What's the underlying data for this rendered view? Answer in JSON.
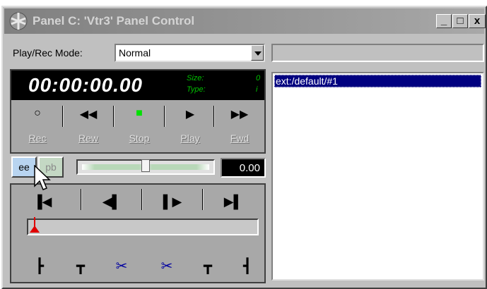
{
  "window": {
    "title": "Panel C: 'Vtr3' Panel Control",
    "controls": [
      "_",
      "□",
      "x"
    ]
  },
  "mode": {
    "label": "Play/Rec Mode:",
    "selected": "Normal"
  },
  "timecode": {
    "value": "00:00:00.00",
    "size_label": "Size:",
    "size_value": "0",
    "type_label": "Type:",
    "type_value": "i"
  },
  "transport": [
    {
      "label": "Rec",
      "icon": "record-circle-icon"
    },
    {
      "label": "Rew",
      "icon": "rewind-icon"
    },
    {
      "label": "Stop",
      "icon": "stop-square-icon"
    },
    {
      "label": "Play",
      "icon": "play-icon"
    },
    {
      "label": "Fwd",
      "icon": "fast-forward-icon"
    }
  ],
  "monitor": {
    "ee_label": "ee",
    "pb_label": "pb",
    "speed": "0.00"
  },
  "list": {
    "items": [
      "ext:/default/#1"
    ]
  },
  "colors": {
    "stop_green": "#00e000",
    "marker_red": "#e00000",
    "selection": "#000080"
  }
}
